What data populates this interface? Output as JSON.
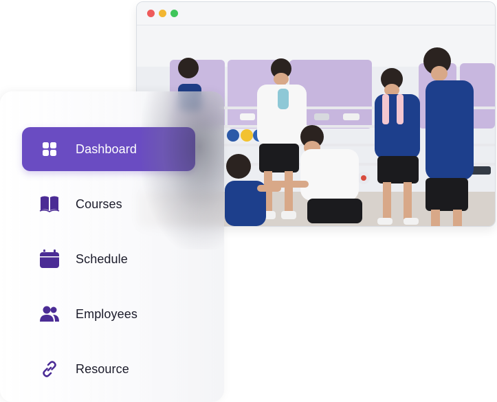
{
  "browser": {
    "controls": [
      "close",
      "minimize",
      "maximize"
    ],
    "photo_subject": "students in gym"
  },
  "sidebar": {
    "items": [
      {
        "label": "Dashboard",
        "icon": "grid-icon",
        "active": true
      },
      {
        "label": "Courses",
        "icon": "book-icon",
        "active": false
      },
      {
        "label": "Schedule",
        "icon": "calendar-icon",
        "active": false
      },
      {
        "label": "Employees",
        "icon": "users-icon",
        "active": false
      },
      {
        "label": "Resource",
        "icon": "link-icon",
        "active": false
      }
    ]
  },
  "colors": {
    "accent": "#6a4cc2",
    "icon": "#4b2c95"
  }
}
